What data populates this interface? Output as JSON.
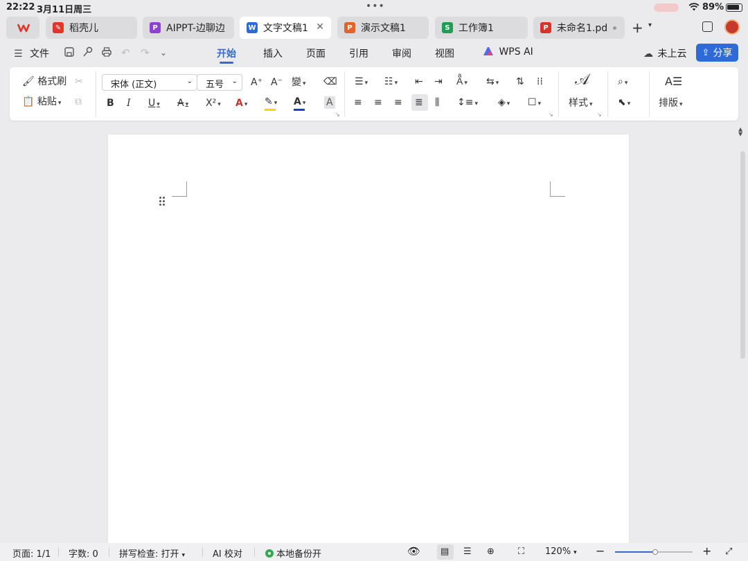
{
  "status": {
    "time": "22:22",
    "date": "3月11日周三",
    "battery": "89%"
  },
  "tabs": [
    {
      "label": "",
      "icon": "wps-logo-icon",
      "color": "#e0352b"
    },
    {
      "label": "稻壳儿",
      "icon": "docer-icon",
      "color": "#e0352b"
    },
    {
      "label": "AIPPT-边聊边",
      "icon": "aippt-icon",
      "color": "#8e3fd6"
    },
    {
      "label": "文字文稿1",
      "icon": "writer-icon",
      "color": "#2f6ad9",
      "glyph": "W"
    },
    {
      "label": "演示文稿1",
      "icon": "presentation-icon",
      "color": "#e2632b",
      "glyph": "P"
    },
    {
      "label": "工作簿1",
      "icon": "spreadsheet-icon",
      "color": "#1f9d55",
      "glyph": "S"
    },
    {
      "label": "未命名1.pd",
      "icon": "pdf-icon",
      "color": "#d8322a",
      "glyph": "P"
    }
  ],
  "menubar": {
    "file": "文件",
    "tabs": [
      "开始",
      "插入",
      "页面",
      "引用",
      "审阅",
      "视图"
    ],
    "active_tab": "开始",
    "wps_ai": "WPS AI",
    "cloud": "未上云",
    "share": "分享"
  },
  "ribbon": {
    "format_painter": "格式刷",
    "paste": "粘贴",
    "font_name": "宋体 (正文)",
    "font_size": "五号",
    "bold": "B",
    "italic": "I",
    "underline": "U",
    "superscript": "X²",
    "styles": "样式",
    "layout": "排版"
  },
  "colors": {
    "accent": "#2f6ad9",
    "highlight": "#f2d600",
    "font_color": "#1a3fd0"
  },
  "bottombar": {
    "page": "页面: 1/1",
    "words": "字数: 0",
    "spellcheck": "拼写检查: 打开",
    "ai_proofread": "AI 校对",
    "backup": "本地备份开",
    "zoom": "120%",
    "zoom_level": 0.52
  }
}
